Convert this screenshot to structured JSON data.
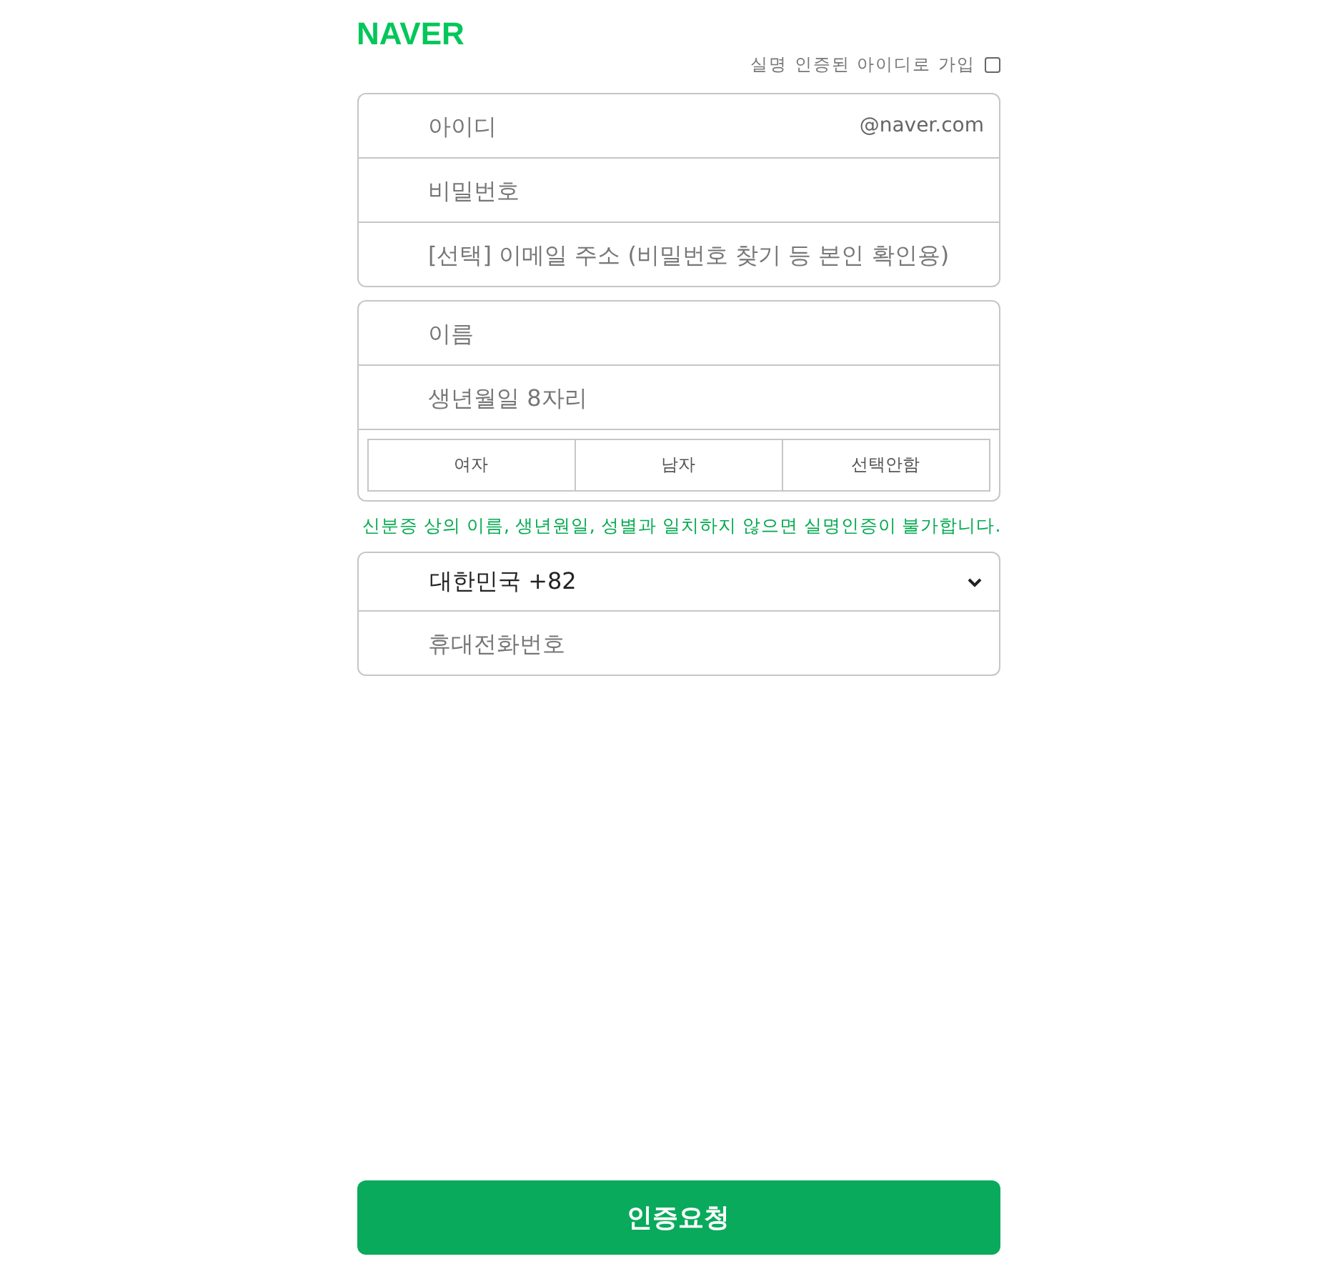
{
  "logo": "NAVER",
  "verified_signup": {
    "label": "실명 인증된 아이디로 가입",
    "checked": false
  },
  "account_fields": [
    {
      "placeholder": "아이디",
      "suffix": "@naver.com"
    },
    {
      "placeholder": "비밀번호"
    },
    {
      "placeholder": "[선택] 이메일 주소 (비밀번호 찾기 등 본인 확인용)"
    }
  ],
  "profile_fields": [
    {
      "placeholder": "이름"
    },
    {
      "placeholder": "생년월일 8자리"
    }
  ],
  "gender_options": [
    {
      "label": "여자",
      "selected": false
    },
    {
      "label": "남자",
      "selected": false
    },
    {
      "label": "선택안함",
      "selected": false
    }
  ],
  "notice": "신분증 상의 이름, 생년원일, 성별과 일치하지 않으면 실명인증이 불가합니다.",
  "country_select": {
    "value": "대한민국 +82"
  },
  "phone_field": {
    "placeholder": "휴대전화번호"
  },
  "submit_button": "인증요청"
}
